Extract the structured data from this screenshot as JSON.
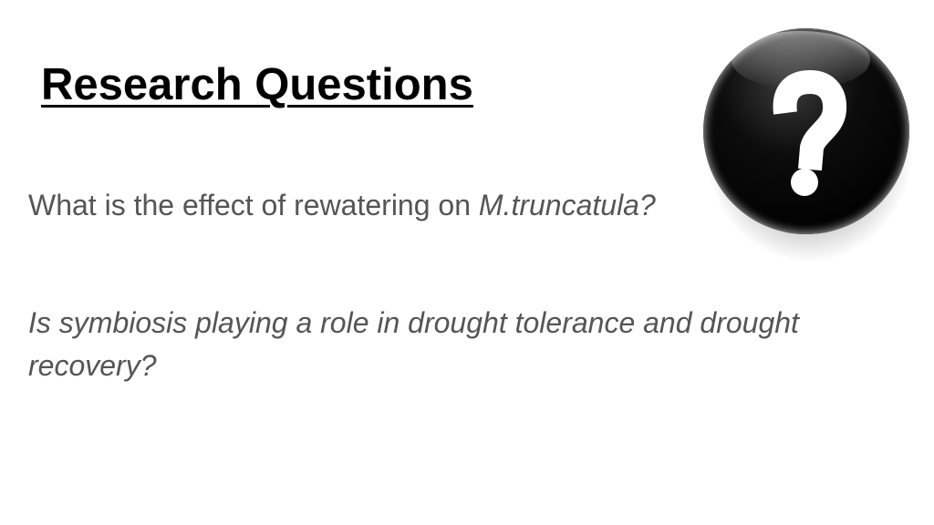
{
  "slide": {
    "title": "Research Questions",
    "question_1": {
      "text": "What is the effect of rewatering on ",
      "species": "M.truncatula?"
    },
    "question_2": "Is symbiosis playing a role in drought tolerance and drought recovery?"
  },
  "icons": {
    "question_button": "question-mark-icon"
  },
  "colors": {
    "title": "#000000",
    "body_text": "#555555",
    "button": "#000000",
    "question_mark": "#ffffff"
  }
}
